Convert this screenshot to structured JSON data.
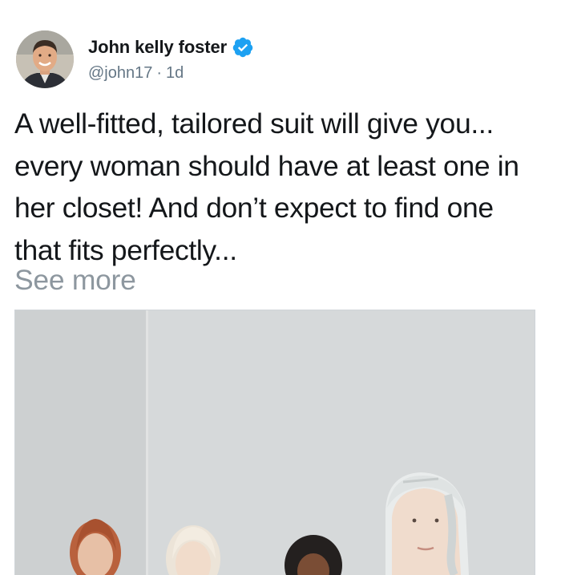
{
  "tweet": {
    "author": {
      "display_name": "John kelly foster",
      "handle": "@john17",
      "verified": true,
      "avatar_icon": "profile-photo"
    },
    "separator": "·",
    "timestamp": "1d",
    "text": "A well-fitted, tailored suit will give you... every woman should have at least one in her closet! And don’t expect to find one that fits perfectly...",
    "see_more_label": "See more",
    "media": {
      "type": "photo",
      "icon": "photo-image"
    }
  },
  "colors": {
    "text": "#14171a",
    "secondary": "#657786",
    "see_more": "#8d979f",
    "verified_blue": "#1da1f2",
    "media_border": "#cfd4d8"
  }
}
